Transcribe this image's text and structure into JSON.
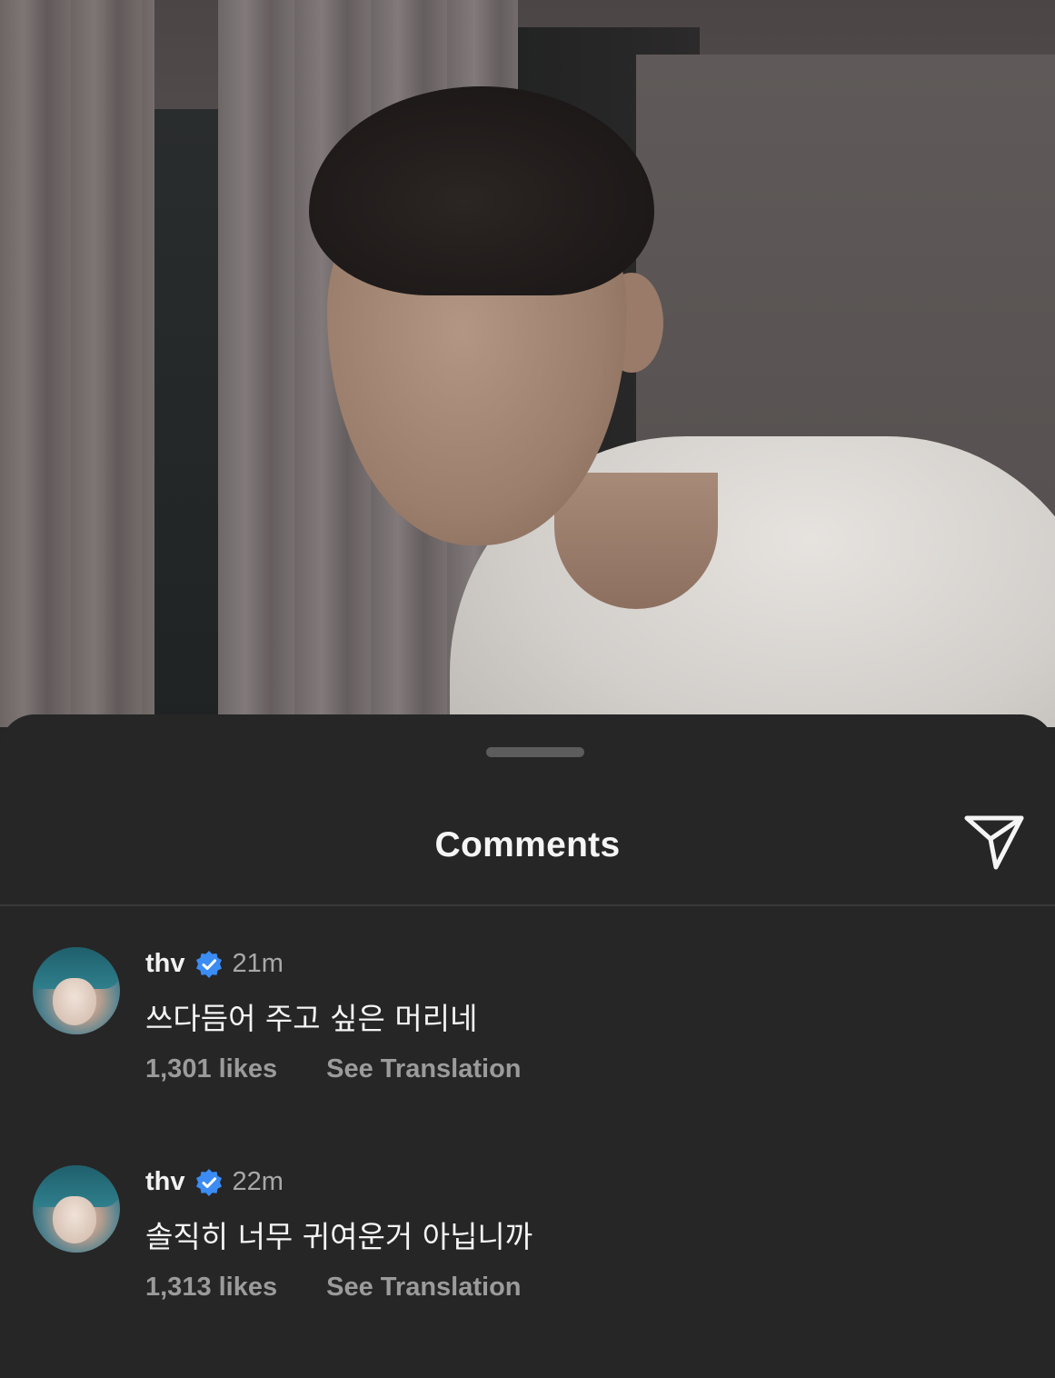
{
  "video": {
    "scene": "person-in-white-tshirt-indoors"
  },
  "sheet": {
    "title": "Comments",
    "share_icon": "paper-plane-icon"
  },
  "comments": [
    {
      "username": "thv",
      "verified": true,
      "time": "21m",
      "text": "쓰다듬어 주고 싶은 머리네",
      "likes": "1,301 likes",
      "translation_label": "See Translation"
    },
    {
      "username": "thv",
      "verified": true,
      "time": "22m",
      "text": "솔직히 너무 귀여운거 아닙니까",
      "likes": "1,313 likes",
      "translation_label": "See Translation"
    }
  ],
  "colors": {
    "sheet_bg": "#262626",
    "verified_badge": "#3b8cf5",
    "secondary_text": "#9b9b9b"
  }
}
